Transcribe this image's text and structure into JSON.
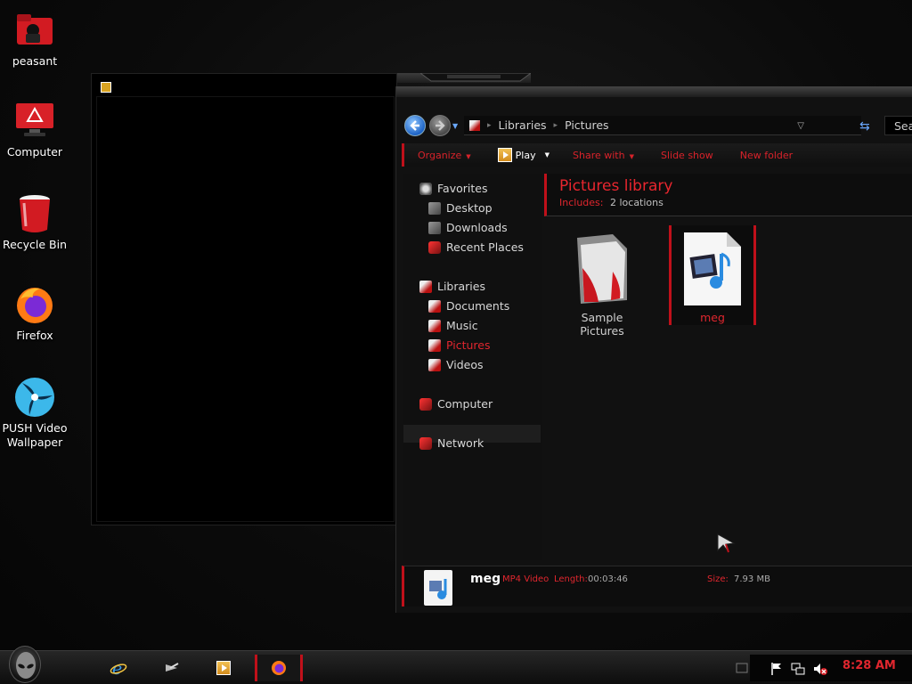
{
  "desktop": {
    "icons": [
      {
        "label": "peasant",
        "icon": "user-folder-icon"
      },
      {
        "label": "Computer",
        "icon": "computer-icon"
      },
      {
        "label": "Recycle Bin",
        "icon": "recycle-bin-icon"
      },
      {
        "label": "Firefox",
        "icon": "firefox-icon"
      },
      {
        "label": "PUSH Video Wallpaper",
        "line1": "PUSH Video",
        "line2": "Wallpaper",
        "icon": "push-video-wallpaper-icon"
      }
    ]
  },
  "explorer": {
    "breadcrumb": [
      "Libraries",
      "Pictures"
    ],
    "search_placeholder": "Search Pictures",
    "toolbar": {
      "organize": "Organize",
      "play": "Play",
      "share_with": "Share with",
      "slide_show": "Slide show",
      "new_folder": "New folder"
    },
    "nav": {
      "favorites": "Favorites",
      "desktop": "Desktop",
      "downloads": "Downloads",
      "recent_places": "Recent Places",
      "libraries": "Libraries",
      "documents": "Documents",
      "music": "Music",
      "pictures": "Pictures",
      "videos": "Videos",
      "computer": "Computer",
      "network": "Network"
    },
    "library": {
      "title": "Pictures library",
      "includes_label": "Includes:",
      "includes_value": "2 locations"
    },
    "items": [
      {
        "line1": "Sample",
        "line2": "Pictures",
        "icon": "folder-icon",
        "selected": false
      },
      {
        "label": "meg",
        "icon": "video-file-icon",
        "selected": true
      }
    ],
    "details": {
      "name": "meg",
      "type": "MP4 Video",
      "length_label": "Length:",
      "length_value": "00:03:46",
      "size_label": "Size:",
      "size_value": "7.93 MB"
    }
  },
  "taskbar": {
    "clock": "8:28 AM",
    "pinned": [
      "internet-explorer-icon",
      "media-center-icon",
      "media-player-icon",
      "firefox-icon"
    ],
    "tray_icons": [
      "flag-icon",
      "network-icon",
      "volume-muted-icon"
    ]
  },
  "colors": {
    "accent": "#e0262e",
    "background": "#0b0b0b",
    "window": "#111111"
  }
}
